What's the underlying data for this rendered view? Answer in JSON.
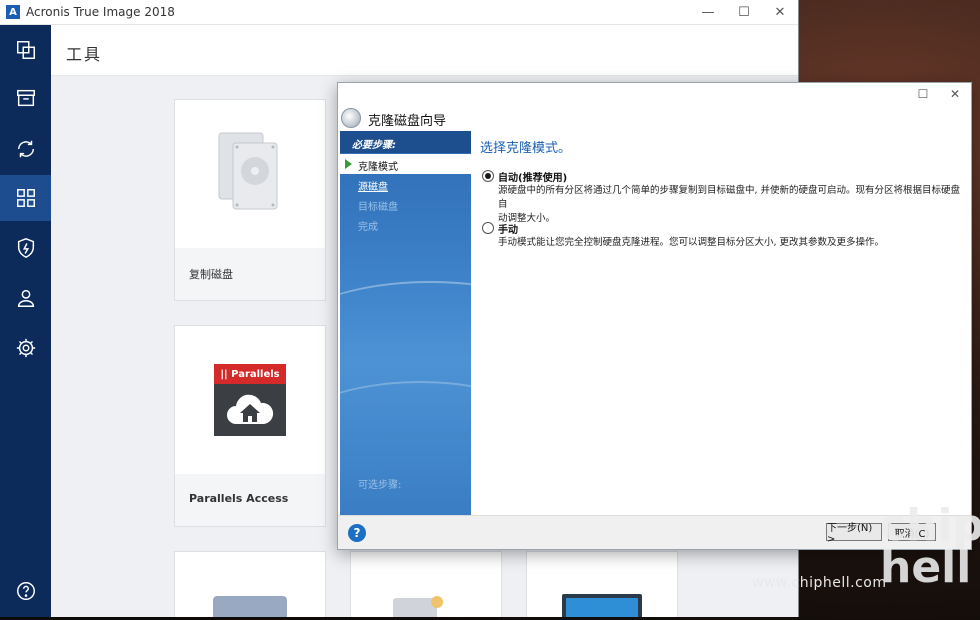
{
  "app": {
    "logo_letter": "A",
    "title": "Acronis True Image 2018",
    "controls": {
      "minimize": "—",
      "maximize": "☐",
      "close": "✕"
    }
  },
  "sidebar": {
    "items": [
      {
        "name": "backup",
        "icon": "copy-icon"
      },
      {
        "name": "archive",
        "icon": "archive-icon"
      },
      {
        "name": "sync",
        "icon": "sync-icon"
      },
      {
        "name": "tools",
        "icon": "grid-icon",
        "active": true
      },
      {
        "name": "protection",
        "icon": "shield-bolt-icon"
      },
      {
        "name": "account",
        "icon": "user-icon"
      },
      {
        "name": "settings",
        "icon": "gear-icon"
      },
      {
        "name": "help",
        "icon": "help-icon"
      }
    ]
  },
  "main": {
    "title": "工具",
    "cards": [
      {
        "label": "复制磁盘",
        "icon": "hard-disk-icon"
      },
      {
        "label": "Parallels Access",
        "icon": "parallels-icon",
        "brand": "|| Parallels"
      },
      {
        "label": "",
        "icon": "disk-icon"
      },
      {
        "label": "",
        "icon": "disk-icon"
      },
      {
        "label": "",
        "icon": "monitor-icon"
      }
    ]
  },
  "wizard": {
    "title": "克隆磁盘向导",
    "controls": {
      "maximize": "☐",
      "close": "✕"
    },
    "steps_header": "必要步骤:",
    "steps": [
      {
        "label": "克隆模式",
        "state": "current"
      },
      {
        "label": "源磁盘",
        "state": "link"
      },
      {
        "label": "目标磁盘",
        "state": "disabled"
      },
      {
        "label": "完成",
        "state": "disabled"
      }
    ],
    "optional_steps": "可选步骤:",
    "heading": "选择克隆模式。",
    "options": [
      {
        "label": "自动(推荐使用)",
        "checked": true,
        "desc_line1": "源硬盘中的所有分区将通过几个简单的步骤复制到目标磁盘中, 并使新的硬盘可启动。现有分区将根据目标硬盘自",
        "desc_line2": "动调整大小。"
      },
      {
        "label": "手动",
        "checked": false,
        "desc_line1": "手动模式能让您完全控制硬盘克隆进程。您可以调整目标分区大小, 更改其参数及更多操作。",
        "desc_line2": ""
      }
    ],
    "help": "?",
    "next_label": "下一步(N) >",
    "cancel_label": "取消(C)"
  },
  "watermark": {
    "site": "www.chiphell.com",
    "logo": "chip hell"
  }
}
